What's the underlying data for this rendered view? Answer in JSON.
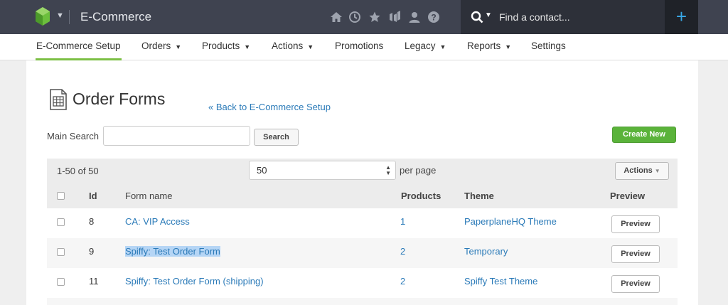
{
  "header": {
    "app_title": "E-Commerce",
    "search_placeholder": "Find a contact...",
    "add_label": "+"
  },
  "nav": {
    "items": [
      {
        "label": "E-Commerce Setup",
        "dropdown": false,
        "active": true
      },
      {
        "label": "Orders",
        "dropdown": true
      },
      {
        "label": "Products",
        "dropdown": true
      },
      {
        "label": "Actions",
        "dropdown": true
      },
      {
        "label": "Promotions",
        "dropdown": false
      },
      {
        "label": "Legacy",
        "dropdown": true
      },
      {
        "label": "Reports",
        "dropdown": true
      },
      {
        "label": "Settings",
        "dropdown": false
      }
    ]
  },
  "page": {
    "title": "Order Forms",
    "back_link": "« Back to E-Commerce Setup",
    "search_label": "Main Search",
    "search_button": "Search",
    "create_button": "Create New"
  },
  "table": {
    "count": "1-50 of 50",
    "per_page_value": "50",
    "per_page_label": "per page",
    "actions_button": "Actions",
    "headers": {
      "id": "Id",
      "form_name": "Form name",
      "products": "Products",
      "theme": "Theme",
      "preview": "Preview"
    },
    "rows": [
      {
        "id": "8",
        "form_name": "CA: VIP Access",
        "products": "1",
        "theme": "PaperplaneHQ Theme",
        "preview": "Preview"
      },
      {
        "id": "9",
        "form_name": "Spiffy: Test Order Form",
        "products": "2",
        "theme": "Temporary",
        "preview": "Preview"
      },
      {
        "id": "11",
        "form_name": "Spiffy: Test Order Form (shipping)",
        "products": "2",
        "theme": "Spiffy Test Theme",
        "preview": "Preview"
      }
    ]
  },
  "colors": {
    "topbar": "#3f4350",
    "accent_green": "#5ab33a",
    "link_blue": "#2a7ab8",
    "add_blue": "#38a9e8"
  },
  "icons": [
    "app-logo-icon",
    "chevron-down-icon",
    "home-icon",
    "clock-icon",
    "star-icon",
    "campaign-icon",
    "contact-icon",
    "help-icon",
    "search-icon",
    "spreadsheet-icon"
  ]
}
